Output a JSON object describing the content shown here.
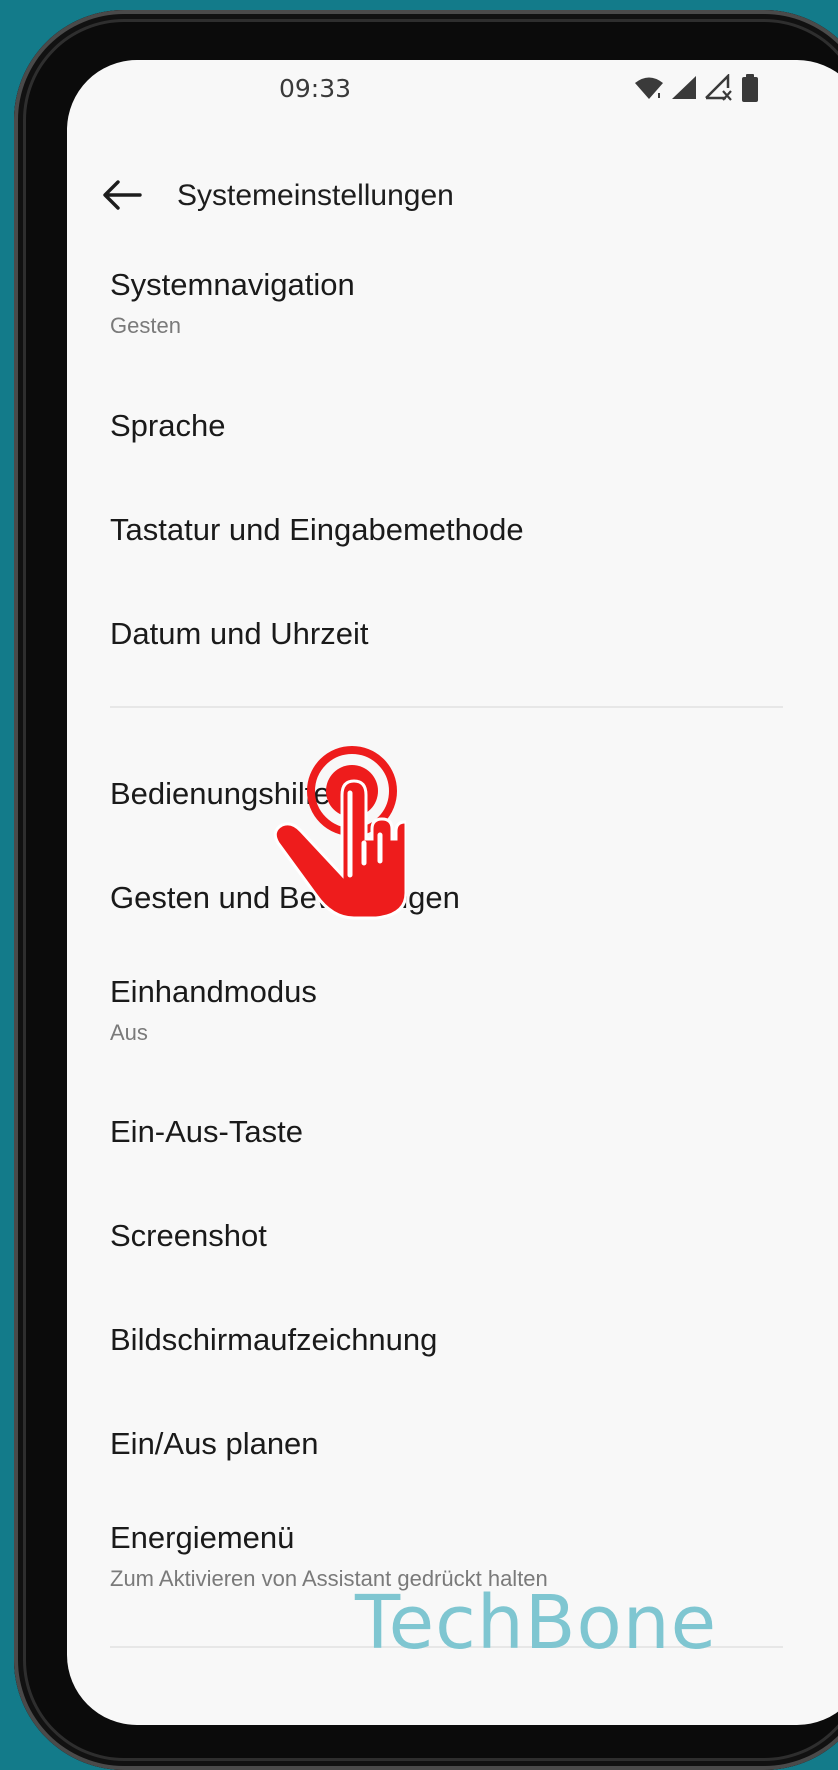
{
  "status_bar": {
    "time": "09:33",
    "icons": [
      "wifi-icon",
      "signal-icon",
      "signal-no-sim-icon",
      "battery-icon"
    ]
  },
  "header": {
    "title": "Systemeinstellungen",
    "back_icon": "arrow-left-icon"
  },
  "settings_group_1": [
    {
      "title": "Systemnavigation",
      "subtitle": "Gesten"
    },
    {
      "title": "Sprache"
    },
    {
      "title": "Tastatur und Eingabemethode"
    },
    {
      "title": "Datum und Uhrzeit"
    }
  ],
  "settings_group_2": [
    {
      "title": "Bedienungshilfen"
    },
    {
      "title": "Gesten und Bewegungen"
    },
    {
      "title": "Einhandmodus",
      "subtitle": "Aus"
    },
    {
      "title": "Ein-Aus-Taste"
    },
    {
      "title": "Screenshot"
    },
    {
      "title": "Bildschirmaufzeichnung"
    },
    {
      "title": "Ein/Aus planen"
    },
    {
      "title": "Energiemenü",
      "subtitle": "Zum Aktivieren von Assistant gedrückt halten"
    }
  ],
  "overlay": {
    "tap_indicator_icon": "tap-hand-icon",
    "tap_color": "#ee1c1c"
  },
  "watermark": "TechBone",
  "colors": {
    "background": "#137b8a",
    "screen": "#f8f8f8",
    "watermark": "#7fc6d1"
  }
}
